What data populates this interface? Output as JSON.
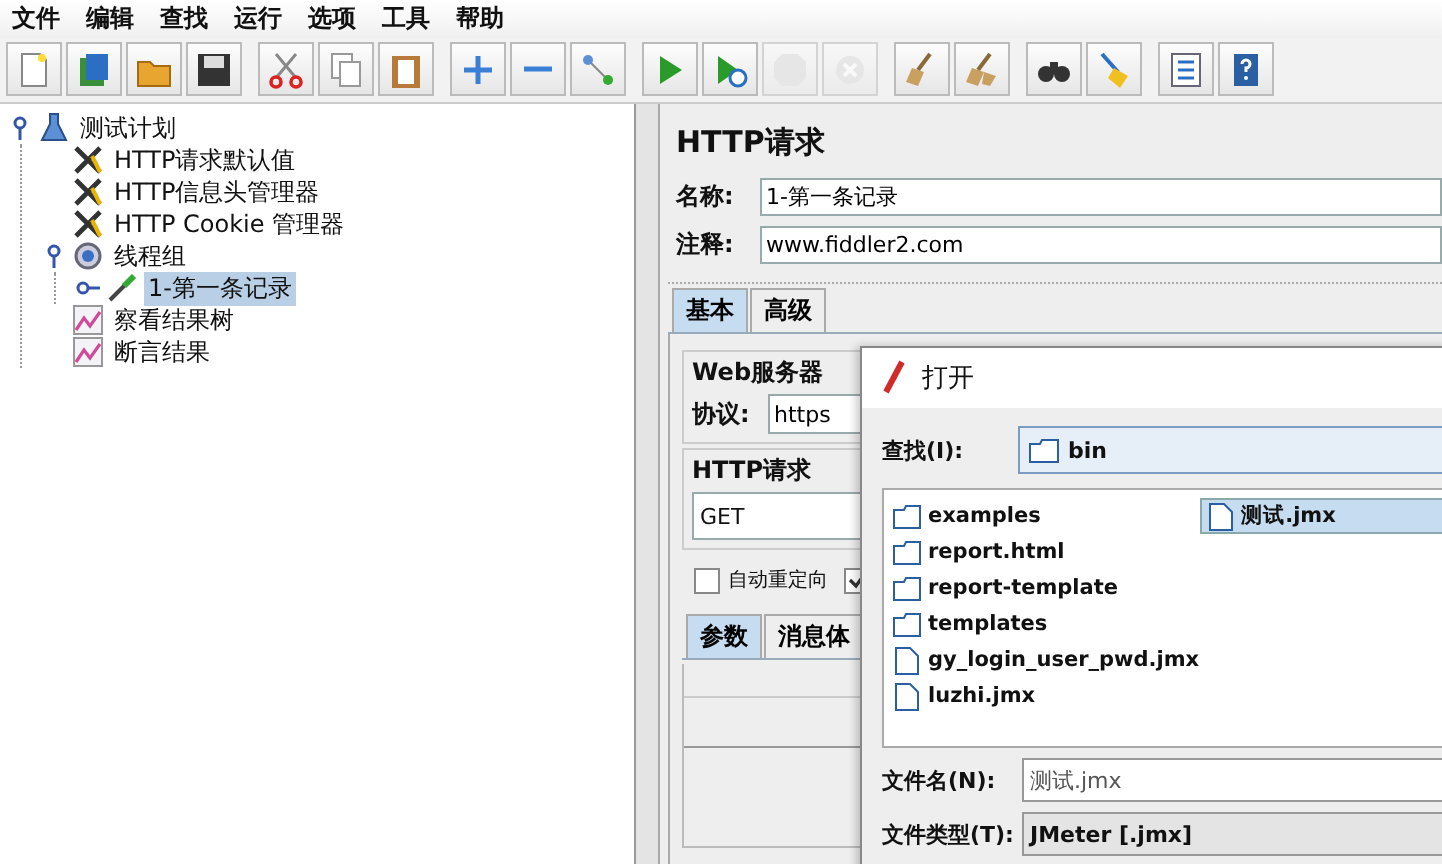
{
  "menu": [
    "文件",
    "编辑",
    "查找",
    "运行",
    "选项",
    "工具",
    "帮助"
  ],
  "toolbar": [
    {
      "buttons": [
        {
          "kind": "new",
          "disabled": false
        },
        {
          "kind": "templates",
          "disabled": false
        },
        {
          "kind": "open",
          "disabled": false
        },
        {
          "kind": "save",
          "disabled": false
        }
      ]
    },
    {
      "buttons": [
        {
          "kind": "cut",
          "disabled": false
        },
        {
          "kind": "copy",
          "disabled": false
        },
        {
          "kind": "paste",
          "disabled": false
        }
      ]
    },
    {
      "buttons": [
        {
          "kind": "expand",
          "disabled": false
        },
        {
          "kind": "collapse",
          "disabled": false
        },
        {
          "kind": "toggle",
          "disabled": false
        }
      ]
    },
    {
      "buttons": [
        {
          "kind": "start",
          "disabled": false
        },
        {
          "kind": "start_no_timers",
          "disabled": false
        },
        {
          "kind": "stop",
          "disabled": true
        },
        {
          "kind": "shutdown",
          "disabled": true
        }
      ]
    },
    {
      "buttons": [
        {
          "kind": "clear",
          "disabled": false
        },
        {
          "kind": "clear_all",
          "disabled": false
        }
      ]
    },
    {
      "buttons": [
        {
          "kind": "search",
          "disabled": false
        },
        {
          "kind": "reset",
          "disabled": false
        }
      ]
    },
    {
      "buttons": [
        {
          "kind": "function",
          "disabled": false
        },
        {
          "kind": "help",
          "disabled": false
        }
      ]
    }
  ],
  "tree": {
    "label": "测试计划",
    "kind": "plan",
    "selected": false,
    "expanded": true,
    "children": [
      {
        "label": "HTTP请求默认值",
        "kind": "config",
        "selected": false
      },
      {
        "label": "HTTP信息头管理器",
        "kind": "config",
        "selected": false
      },
      {
        "label": "HTTP Cookie 管理器",
        "kind": "config",
        "selected": false
      },
      {
        "label": "线程组",
        "kind": "threadgroup",
        "selected": false,
        "expanded": true,
        "children": [
          {
            "label": "1-第一条记录",
            "kind": "sampler",
            "selected": true,
            "expanded": false
          }
        ]
      },
      {
        "label": "察看结果树",
        "kind": "listener",
        "selected": false
      },
      {
        "label": "断言结果",
        "kind": "listener",
        "selected": false
      }
    ]
  },
  "editor": {
    "title": "HTTP请求",
    "fields": [
      {
        "label": "名称:",
        "value": "1-第一条记录"
      },
      {
        "label": "注释:",
        "value": "www.fiddler2.com"
      }
    ],
    "tabs": [
      {
        "label": "基本",
        "selected": true
      },
      {
        "label": "高级",
        "selected": false
      }
    ],
    "web_server": {
      "legend": "Web服务器",
      "protocol_label": "协议:",
      "protocol_value": "https"
    },
    "http_request": {
      "legend": "HTTP请求",
      "method": "GET"
    },
    "checkboxes": [
      {
        "label": "自动重定向",
        "checked": false
      },
      {
        "checked": true
      }
    ],
    "inner_tabs": [
      {
        "label": "参数",
        "selected": true
      },
      {
        "label": "消息体",
        "selected": false
      }
    ]
  },
  "dialog": {
    "title": "打开",
    "look_in_label": "查找(I):",
    "look_in_value": "bin",
    "files": [
      {
        "name": "examples",
        "kind": "folder",
        "selected": false
      },
      {
        "name": "report.html",
        "kind": "folder",
        "selected": false
      },
      {
        "name": "report-template",
        "kind": "folder",
        "selected": false
      },
      {
        "name": "templates",
        "kind": "folder",
        "selected": false
      },
      {
        "name": "gy_login_user_pwd.jmx",
        "kind": "file",
        "selected": false
      },
      {
        "name": "luzhi.jmx",
        "kind": "file",
        "selected": false
      },
      {
        "name": "测试.jmx",
        "kind": "file",
        "selected": true
      }
    ],
    "file_name_label": "文件名(N):",
    "file_name_value": "测试.jmx",
    "file_type_label": "文件类型(T):",
    "file_type_value": "JMeter [.jmx]"
  }
}
